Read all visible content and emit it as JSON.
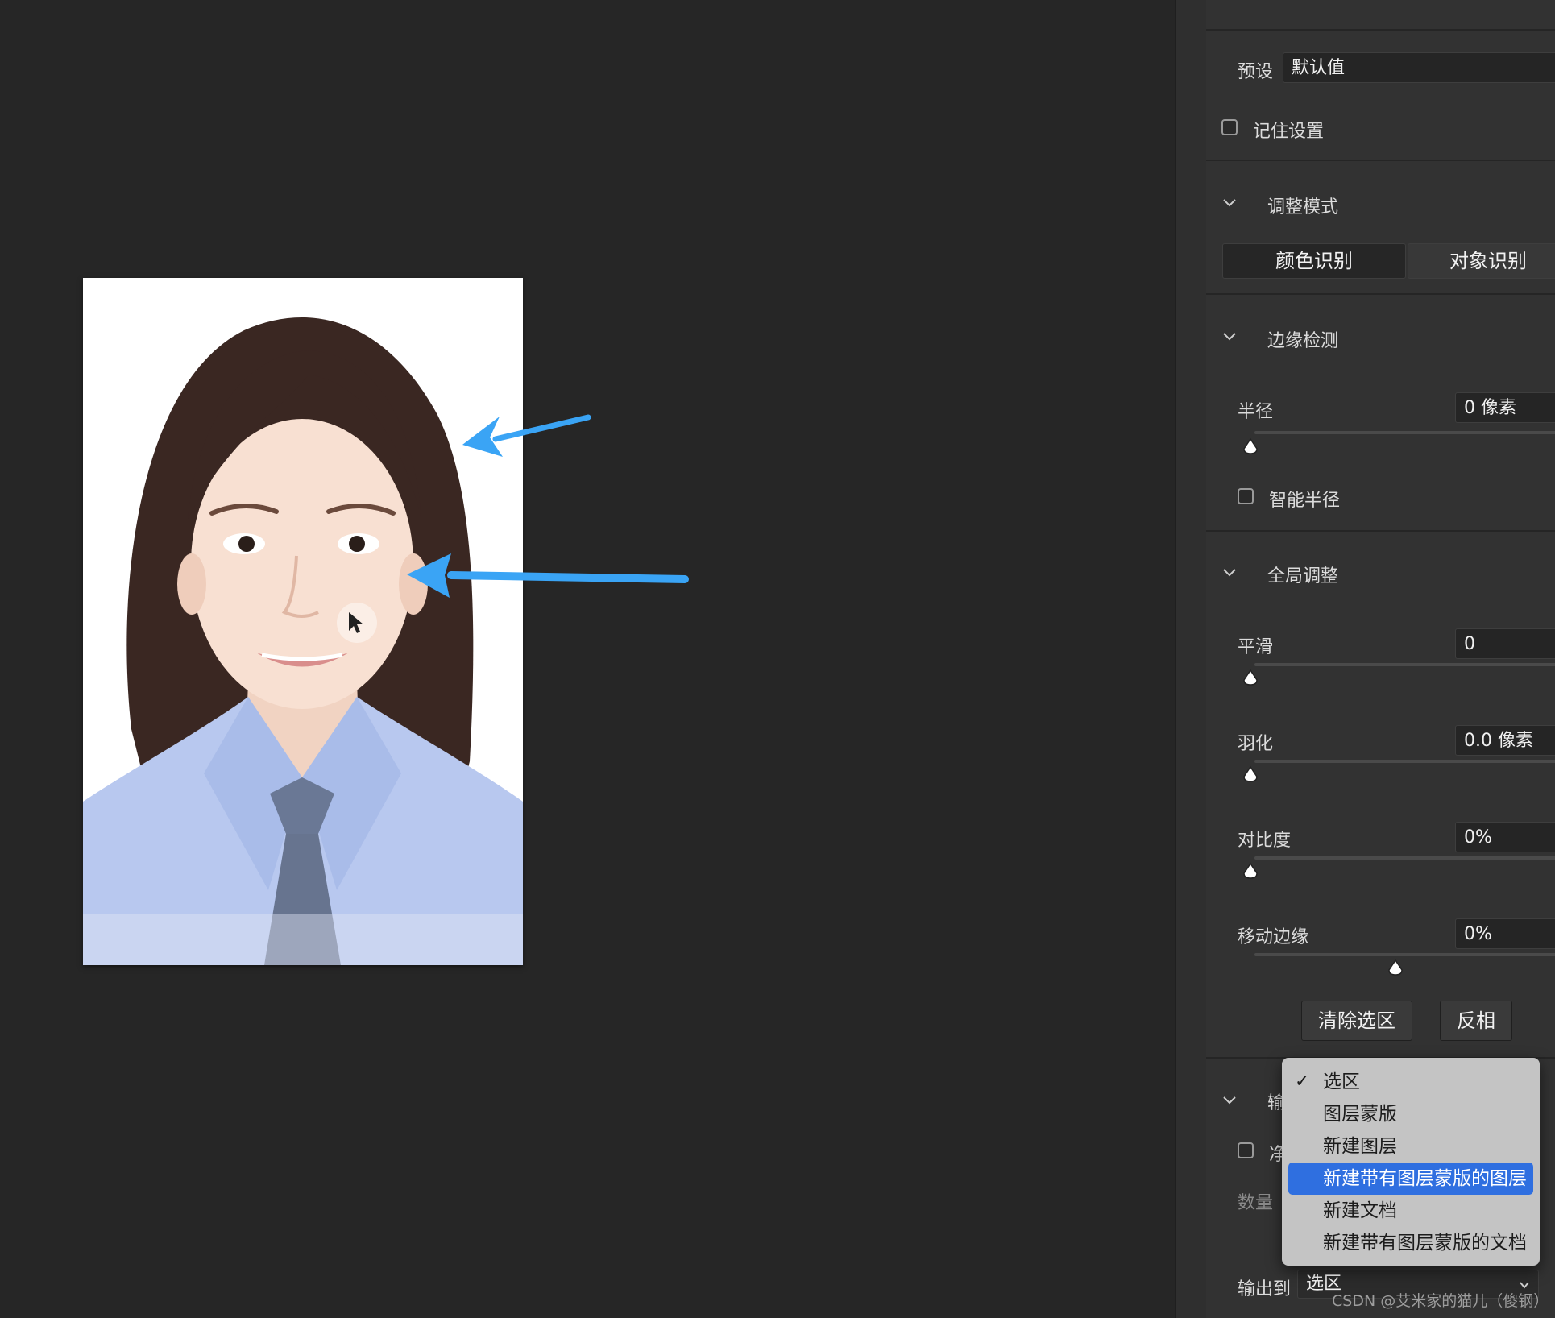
{
  "panel": {
    "preset_label": "预设",
    "preset_value": "默认值",
    "remember_label": "记住设置",
    "adjust_mode_title": "调整模式",
    "mode_color": "颜色识别",
    "mode_object": "对象识别",
    "edge_title": "边缘检测",
    "radius_label": "半径",
    "radius_value": "0 像素",
    "smart_radius_label": "智能半径",
    "global_title": "全局调整",
    "smooth_label": "平滑",
    "smooth_value": "0",
    "feather_label": "羽化",
    "feather_value": "0.0 像素",
    "contrast_label": "对比度",
    "contrast_value": "0%",
    "shift_label": "移动边缘",
    "shift_value": "0%",
    "shift_level": 0.5,
    "clear_button": "清除选区",
    "invert_button": "反相",
    "output_title_partial": "输",
    "decontaminate_partial": "净",
    "amount_partial": "数量",
    "output_to_label": "输出到",
    "output_to_value": "选区"
  },
  "dropdown": {
    "check_glyph": "✓",
    "options": [
      "选区",
      "图层蒙版",
      "新建图层",
      "新建带有图层蒙版的图层",
      "新建文档",
      "新建带有图层蒙版的文档"
    ],
    "selected_index": 0,
    "highlighted_index": 3
  },
  "watermark": "CSDN @艾米家的猫儿（傻钢）",
  "colors": {
    "annotation_arrow": "#3aa4f5",
    "highlight": "#2f6fe0"
  }
}
